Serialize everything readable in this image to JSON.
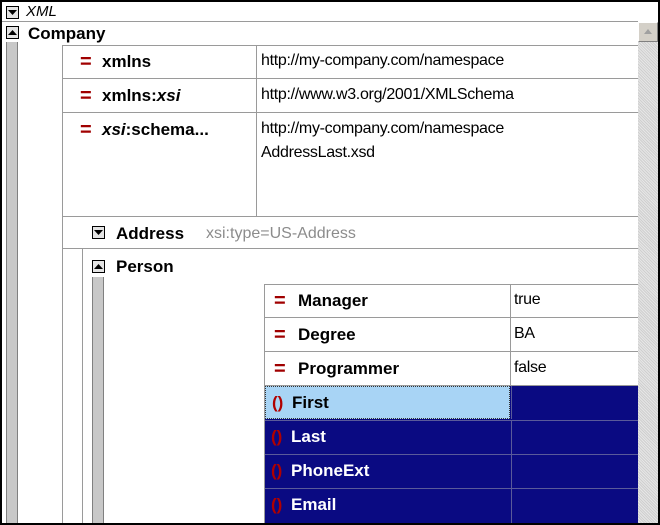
{
  "header": {
    "title": "XML"
  },
  "company": {
    "label": "Company"
  },
  "attributes": [
    {
      "name": "xmlns",
      "value": "http://my-company.com/namespace"
    },
    {
      "name_prefix": "xmlns:",
      "name_italic": "xsi",
      "value": "http://www.w3.org/2001/XMLSchema"
    },
    {
      "name_italic": "xsi",
      "name_suffix": ":schema...",
      "value": "http://my-company.com/namespace",
      "value2": "AddressLast.xsd"
    }
  ],
  "address": {
    "label": "Address",
    "type_text": "xsi:type=US-Address"
  },
  "person": {
    "label": "Person",
    "attributes": [
      {
        "name": "Manager",
        "value": "true"
      },
      {
        "name": "Degree",
        "value": "BA"
      },
      {
        "name": "Programmer",
        "value": "false"
      }
    ],
    "children": [
      "First",
      "Last",
      "PhoneExt",
      "Email"
    ]
  },
  "colors": {
    "selection": "#0a0a82",
    "focus": "#a8d4f5",
    "icon_red": "#a00000"
  },
  "icons": [
    "collapse-toggle-icon",
    "attribute-icon",
    "element-icon"
  ]
}
